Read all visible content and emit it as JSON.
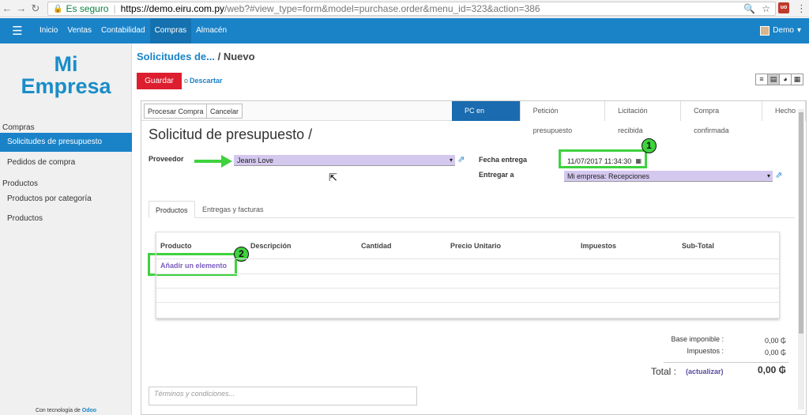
{
  "browser": {
    "secure_label": "Es seguro",
    "url_host": "https://demo.eiru.com.py",
    "url_rest": "/web?#view_type=form&model=purchase.order&menu_id=323&action=386"
  },
  "topbar": {
    "menu": [
      "Inicio",
      "Ventas",
      "Contabilidad",
      "Compras",
      "Almacén"
    ],
    "active": "Compras",
    "user": "Demo"
  },
  "sidebar": {
    "logo_line1": "Mi",
    "logo_line2": "Empresa",
    "section_compras": "Compras",
    "item_solicitudes": "Solicitudes de presupuesto",
    "item_pedidos": "Pedidos de compra",
    "section_productos": "Productos",
    "item_productos_categoria": "Productos por categoría",
    "item_productos": "Productos",
    "footer_prefix": "Con tecnología de",
    "footer_brand": "Odoo"
  },
  "breadcrumb": {
    "parent": "Solicitudes de...",
    "separator": "/",
    "current": "Nuevo"
  },
  "actions": {
    "save": "Guardar",
    "or": "o",
    "discard": "Descartar"
  },
  "header_buttons": {
    "process": "Procesar Compra",
    "cancel": "Cancelar"
  },
  "stages": [
    "PC en borrador",
    "Petición presupuesto",
    "Licitación recibida",
    "Compra confirmada",
    "Hecho"
  ],
  "active_stage": "PC en borrador",
  "form": {
    "title": "Solicitud de presupuesto /",
    "supplier_label": "Proveedor",
    "supplier_value": "Jeans Love",
    "date_label": "Fecha entrega",
    "date_value": "11/07/2017 11:34:30",
    "deliver_label": "Entregar a",
    "deliver_value": "Mi empresa: Recepciones"
  },
  "annotations": {
    "badge1": "1",
    "badge2": "2",
    "highlight_color": "#3ed23e"
  },
  "tabs": [
    "Productos",
    "Entregas y facturas"
  ],
  "table": {
    "columns": [
      "Producto",
      "Descripción",
      "Cantidad",
      "Precio Unitario",
      "Impuestos",
      "Sub-Total"
    ],
    "add_line": "Añadir un elemento"
  },
  "totals": {
    "base_label": "Base imponible :",
    "base_value": "0,00 ₲",
    "tax_label": "Impuestos :",
    "tax_value": "0,00 ₲",
    "total_label": "Total :",
    "update_link": "(actualizar)",
    "total_value": "0,00 ₲"
  },
  "notes_placeholder": "Términos y condiciones...",
  "colors": {
    "primary": "#1a83c8",
    "save": "#dc1e2e",
    "field_bg": "#d4c8ef",
    "active_stage": "#1a6bb0"
  }
}
